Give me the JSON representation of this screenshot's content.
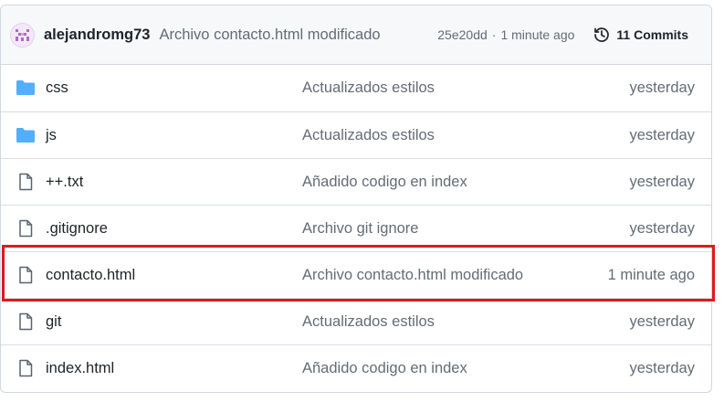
{
  "commit": {
    "author": "alejandromg73",
    "message": "Archivo contacto.html modificado",
    "sha": "25e20dd",
    "separator": "·",
    "time": "1 minute ago",
    "commits_label": "11 Commits"
  },
  "files": [
    {
      "name": "css",
      "type": "folder",
      "message": "Actualizados estilos",
      "time": "yesterday"
    },
    {
      "name": "js",
      "type": "folder",
      "message": "Actualizados estilos",
      "time": "yesterday"
    },
    {
      "name": "++.txt",
      "type": "file",
      "message": "Añadido codigo en index",
      "time": "yesterday"
    },
    {
      "name": ".gitignore",
      "type": "file",
      "message": "Archivo git ignore",
      "time": "yesterday"
    },
    {
      "name": "contacto.html",
      "type": "file",
      "message": "Archivo contacto.html modificado",
      "time": "1 minute ago",
      "highlighted": true
    },
    {
      "name": "git",
      "type": "file",
      "message": "Actualizados estilos",
      "time": "yesterday"
    },
    {
      "name": "index.html",
      "type": "file",
      "message": "Añadido codigo en index",
      "time": "yesterday"
    }
  ],
  "colors": {
    "folder": "#54aeff",
    "highlight": "#e0191b",
    "muted_text": "#636c76"
  }
}
